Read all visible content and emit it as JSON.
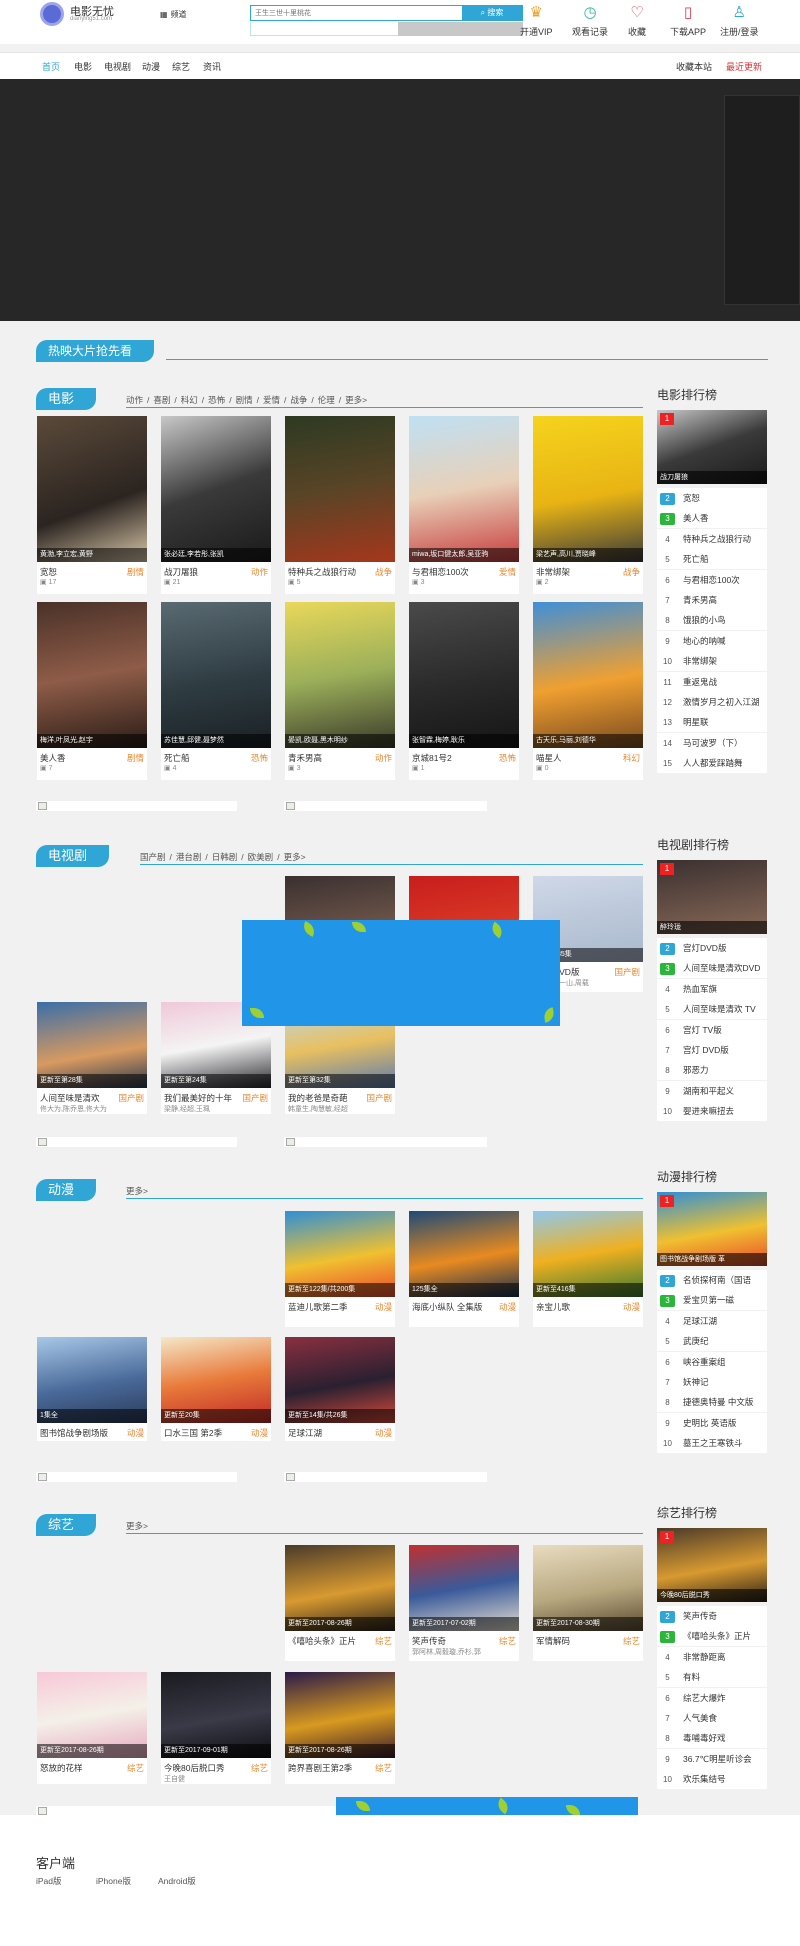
{
  "header": {
    "logo_title": "电影无忧",
    "logo_sub": "dianying51.com",
    "category_label": "频道",
    "search_placeholder": "王生三世十里桃花",
    "search_button": "搜索",
    "tools": [
      {
        "icon": "crown-icon",
        "glyph": "♛",
        "color": "#e8a52b",
        "label": "开通VIP"
      },
      {
        "icon": "clock-icon",
        "glyph": "◷",
        "color": "#2bb5a0",
        "label": "观看记录"
      },
      {
        "icon": "heart-icon",
        "glyph": "♡",
        "color": "#e23b4e",
        "label": "收藏"
      },
      {
        "icon": "phone-icon",
        "glyph": "▯",
        "color": "#e23b4e",
        "label": "下载APP"
      },
      {
        "icon": "user-icon",
        "glyph": "♙",
        "color": "#2fa6d5",
        "label": "注册/登录"
      }
    ]
  },
  "nav": {
    "items": [
      "首页",
      "电影",
      "电视剧",
      "动漫",
      "综艺",
      "资讯"
    ],
    "bookmark": "收藏本站",
    "recent": "最近更新"
  },
  "hot_title": "热映大片抢先看",
  "movies": {
    "title": "电影",
    "tags": [
      "动作",
      "喜剧",
      "科幻",
      "恐怖",
      "剧情",
      "爱情",
      "战争",
      "伦理",
      "更多>"
    ],
    "cards": [
      {
        "cap": "黄渤,李立宏,黄野",
        "title": "宽恕",
        "type": "剧情",
        "count": "17",
        "bg": "linear-gradient(160deg,#5b4a3a,#2b2420 60%,#d9c7a8)"
      },
      {
        "cap": "张必廷,李若彤,张凯",
        "title": "战刀屠狼",
        "type": "动作",
        "count": "21",
        "bg": "linear-gradient(160deg,#c8c8c8,#3a3a3a 50%,#1a1a1a)"
      },
      {
        "cap": "",
        "title": "特种兵之战狼行动",
        "type": "战争",
        "count": "5",
        "bg": "linear-gradient(170deg,#2c3a22,#5a4426 50%,#a5371c)"
      },
      {
        "cap": "miwa,坂口健太郎,吴亚驹",
        "title": "与君相恋100次",
        "type": "爱情",
        "count": "3",
        "bg": "linear-gradient(170deg,#bfe0f4,#e8d0b8 50%,#c63c3c)"
      },
      {
        "cap": "梁艺声,高川,贾晓峰",
        "title": "非常绑架",
        "type": "战争",
        "count": "2",
        "bg": "linear-gradient(170deg,#f5d31d,#e8b414 55%,#3a3a3a)"
      },
      {
        "cap": "梅洋,叶凤光,赵宇",
        "title": "美人香",
        "type": "剧情",
        "count": "7",
        "bg": "linear-gradient(170deg,#4a3128,#8e5c48 50%,#2a1c16)"
      },
      {
        "cap": "苏佳慧,邱健,聂梦然",
        "title": "死亡船",
        "type": "恐怖",
        "count": "4",
        "bg": "linear-gradient(170deg,#5a6a72,#2e3c42 55%,#1a2024)"
      },
      {
        "cap": "晏凯,欧聂,黑木明纱",
        "title": "青禾男高",
        "type": "动作",
        "count": "3",
        "bg": "linear-gradient(170deg,#e9d85a,#9cb05a 50%,#3a3a2a)"
      },
      {
        "cap": "张智霖,梅婷,耿乐",
        "title": "京城81号2",
        "type": "恐怖",
        "count": "1",
        "bg": "linear-gradient(170deg,#4a4a4a,#2a2a2a 55%,#151515)"
      },
      {
        "cap": "古天乐,马丽,刘德华",
        "title": "喵星人",
        "type": "科幻",
        "count": "0",
        "bg": "linear-gradient(170deg,#3f8fd8,#f0a030 55%,#7a4a20)"
      }
    ],
    "rank_title": "电影排行榜",
    "rank_top_cap": "战刀屠狼",
    "rank": [
      "宽恕",
      "美人香",
      "特种兵之战狼行动",
      "死亡船",
      "与君相恋100次",
      "青禾男高",
      "饿狼的小鸟",
      "地心的呐喊",
      "非常绑架",
      "重返鬼战",
      "激情岁月之初入江湖",
      "明星联",
      "马可波罗（下）",
      "人人都爱踩踏舞"
    ]
  },
  "tv": {
    "title": "电视剧",
    "tags": [
      "国产剧",
      "港台剧",
      "日韩剧",
      "欧美剧",
      "更多>"
    ],
    "cards_top": [
      {
        "cap": "",
        "title": "",
        "type": "",
        "sub": "",
        "bg": "linear-gradient(170deg,#3a3030,#8a6a58)"
      },
      {
        "cap": "",
        "title": "",
        "type": "",
        "sub": "",
        "bg": "linear-gradient(170deg,#c81d1d,#e24a2a)"
      },
      {
        "cap": "更新至35集",
        "title": "剧场DVD版",
        "type": "国产剧",
        "sub": "蒋欣,张一山,周载",
        "bg": "linear-gradient(170deg,#cfd8e8,#a8b8cc)"
      }
    ],
    "cards": [
      {
        "cap": "更新至第28集",
        "title": "人间至味是清欢",
        "type": "国产剧",
        "sub": "佟大为,陈乔恩,佟大为",
        "bg": "linear-gradient(170deg,#3a6ea8,#d89a60 60%,#2a3a50)"
      },
      {
        "cap": "更新至第24集",
        "title": "我们最美好的十年",
        "type": "国产剧",
        "sub": "梁静,经超,王珮",
        "bg": "linear-gradient(170deg,#f0c8d8,#f4f4f4 50%,#2a2a30)"
      },
      {
        "cap": "更新至第32集",
        "title": "我的老爸是奇葩",
        "type": "国产剧",
        "sub": "韩童生,陶慧敏,经超",
        "bg": "linear-gradient(170deg,#b8d8f0,#e8c060 50%,#5a7ab0)"
      }
    ],
    "rank_title": "电视剧排行榜",
    "rank_top_cap": "醉玲珑",
    "rank": [
      "宫灯DVD版",
      "人间至味是清欢DVD",
      "热血军旗",
      "人间至味是清欢 TV",
      "宫灯 TV版",
      "宫灯 DVD版",
      "邪恶力",
      "湖南和平起义",
      "婴进来嘛扭去"
    ]
  },
  "anime": {
    "title": "动漫",
    "tags": [
      "更多>"
    ],
    "cards_top": [
      {
        "cap": "更新至122集/共200集",
        "title": "蓝迪儿歌第二季",
        "type": "动漫",
        "bg": "linear-gradient(170deg,#2f8fd8,#f0c030 55%,#e84a2a)"
      },
      {
        "cap": "125集全",
        "title": "海底小纵队 全集版",
        "type": "动漫",
        "bg": "linear-gradient(170deg,#1e4a78,#e88a20 55%,#1a3050)"
      },
      {
        "cap": "更新至416集",
        "title": "亲宝儿歌",
        "type": "动漫",
        "bg": "linear-gradient(170deg,#8ec8f0,#f0b020 50%,#3a7a30)"
      }
    ],
    "cards": [
      {
        "cap": "1集全",
        "title": "图书馆战争剧场版",
        "type": "动漫",
        "bg": "linear-gradient(170deg,#a8c8e8,#4a6a9a 55%,#2a3a5a)"
      },
      {
        "cap": "更新至20集",
        "title": "口水三国 第2季",
        "type": "动漫",
        "bg": "linear-gradient(170deg,#f4e8c8,#e87a3a 50%,#c02828)"
      },
      {
        "cap": "更新至14集/共26集",
        "title": "足球江湖",
        "type": "动漫",
        "bg": "linear-gradient(170deg,#8a3040,#2a2030 55%,#d84a3a)"
      }
    ],
    "rank_title": "动漫排行榜",
    "rank_top_cap": "图书馆战争剧场版 革",
    "rank": [
      "名侦探柯南（国语",
      "爱宝贝第一磁",
      "足球江湖",
      "武庚纪",
      "峡谷重案组",
      "妖神记",
      "捷德奥特曼 中文版",
      "史明比 英语版",
      "墓王之王寒铁斗"
    ]
  },
  "variety": {
    "title": "综艺",
    "tags": [
      "更多>"
    ],
    "cards_top": [
      {
        "cap": "更新至2017-08-26期",
        "title": "《嘻哈头条》正片",
        "type": "综艺",
        "sub": "",
        "bg": "linear-gradient(170deg,#4a3a2a,#d89a30 55%,#2a2218)"
      },
      {
        "cap": "更新至2017-07-02期",
        "title": "笑声传奇",
        "type": "综艺",
        "sub": "郭阿林,周毅璇,乔杉,郭",
        "bg": "linear-gradient(170deg,#c03030,#3a5a9a 50%,#e8e0d0)"
      },
      {
        "cap": "更新至2017-08-30期",
        "title": "军情解码",
        "type": "综艺",
        "sub": "",
        "bg": "linear-gradient(170deg,#e8dcc0,#b8a880 55%,#5a4a30)"
      }
    ],
    "cards": [
      {
        "cap": "更新至2017-08-26期",
        "title": "怒放的花样",
        "type": "综艺",
        "sub": "",
        "bg": "linear-gradient(170deg,#f8c8d8,#f4f0e8 50%,#e8a8c0)"
      },
      {
        "cap": "更新至2017-09-01期",
        "title": "今晚80后脱口秀",
        "type": "综艺",
        "sub": "王自健",
        "bg": "linear-gradient(170deg,#1a1a20,#3a3a48 55%,#0e0e12)"
      },
      {
        "cap": "更新至2017-08-26期",
        "title": "跨界喜剧王第2季",
        "type": "综艺",
        "sub": "",
        "bg": "linear-gradient(170deg,#2a1a4a,#d89a20 55%,#3a1a2a)"
      }
    ],
    "rank_title": "综艺排行榜",
    "rank_top_cap": "今晚80后脱口秀",
    "rank": [
      "笑声传奇",
      "《嘻哈头条》正片",
      "非常静距离",
      "有料",
      "综艺大爆炸",
      "人气美食",
      "毒哺毒好戏",
      "36.7℃明星听诊会",
      "欢乐集结号"
    ]
  },
  "footer": {
    "title": "客户端",
    "links": [
      "iPad版",
      "iPhone版",
      "Android版"
    ]
  }
}
